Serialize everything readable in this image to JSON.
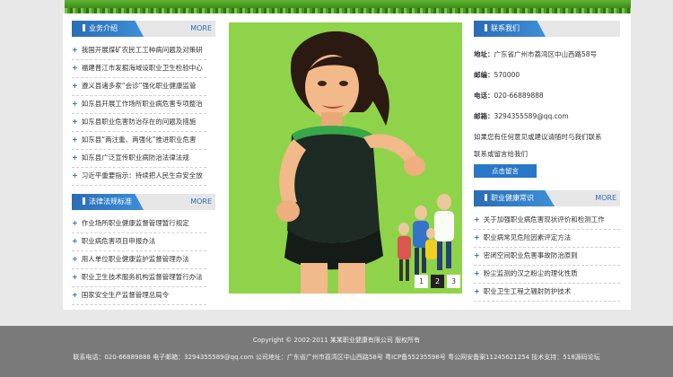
{
  "left": {
    "business": {
      "title": "业务介绍",
      "more": "MORE",
      "items": [
        "我国开展煤矿农民工工种病问题及对策研",
        "福建晋江市发掘海域设职业卫生检验中心",
        "遵义县诸多家“会诊”强化职业健康监管",
        "如东县开展工作场所职业病危害专项整治",
        "如东县职业危害防治存在的问题及措施",
        "如东县“两注重、两强化”推进职业危害",
        "如东县广泛宣传职业病防治法律法规",
        "习近平重要指示：持续把人民生命安全放"
      ]
    },
    "laws": {
      "title": "法律法规标准",
      "more": "MORE",
      "items": [
        "作业场所职业健康监督管理暂行规定",
        "职业病危害项目申报办法",
        "用人单位职业健康监护监督管理办法",
        "职业卫生技术服务机构监督管理暂行办法",
        "国家安全生产监督管理总局令"
      ]
    }
  },
  "slider": {
    "pages": [
      "1",
      "2",
      "3"
    ],
    "active_page": "2"
  },
  "right": {
    "contact": {
      "title": "联系我们",
      "address_label": "地址：",
      "address": "广东省广州市荔湾区中山西路58号",
      "zip_label": "邮编：",
      "zip": "570000",
      "phone_label": "电话：",
      "phone": "020-66889888",
      "email_label": "邮箱：",
      "email": "3294355589@qq.com",
      "note": "如果您有任何意见或建议请随时与我们联系",
      "note2": "联系或留言给我们",
      "button": "点击留言"
    },
    "health": {
      "title": "职业健康常识",
      "more": "MORE",
      "items": [
        "关于加强职业病危害现状评价和检测工作",
        "职业病常见危险因素评定方法",
        "密闭空间职业危害事故防治原则",
        "粉尘监测的汉之粉尘的理化性质",
        "职业卫生工程之辐射防护技术"
      ]
    }
  },
  "footer": {
    "copyright": "Copyright © 2002-2011 某某职业健康有限公司 版权所有",
    "info": "联系电话：020-66889888 电子邮箱：3294355589@qq.com 公司地址：广东省广州市荔湾区中山西路58号 粤ICP备55235598号 粤公网安备案11245621254 技术支持：518源码论坛"
  },
  "colors": {
    "accent": "#2a6db5",
    "hero_bg": "#8fd34a",
    "footer_bg": "#7a7a7a"
  }
}
